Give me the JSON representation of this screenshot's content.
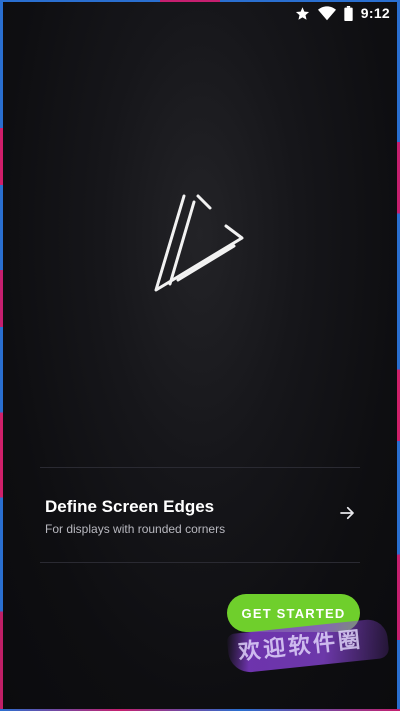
{
  "status_bar": {
    "time": "9:12",
    "icons": [
      "star-icon",
      "wifi-icon",
      "battery-icon"
    ]
  },
  "logo": {
    "icon": "triangle-play-logo"
  },
  "option": {
    "title": "Define Screen Edges",
    "subtitle": "For displays with rounded corners",
    "icon": "arrow-right-icon"
  },
  "get_started": {
    "label": "GET STARTED"
  },
  "watermark": {
    "text": "欢迎软件圈"
  },
  "colors": {
    "accent": "#6fcf2c",
    "background": "#0e0e11",
    "edge_blue": "#2a6fd0",
    "edge_pink": "#c61f6f"
  }
}
